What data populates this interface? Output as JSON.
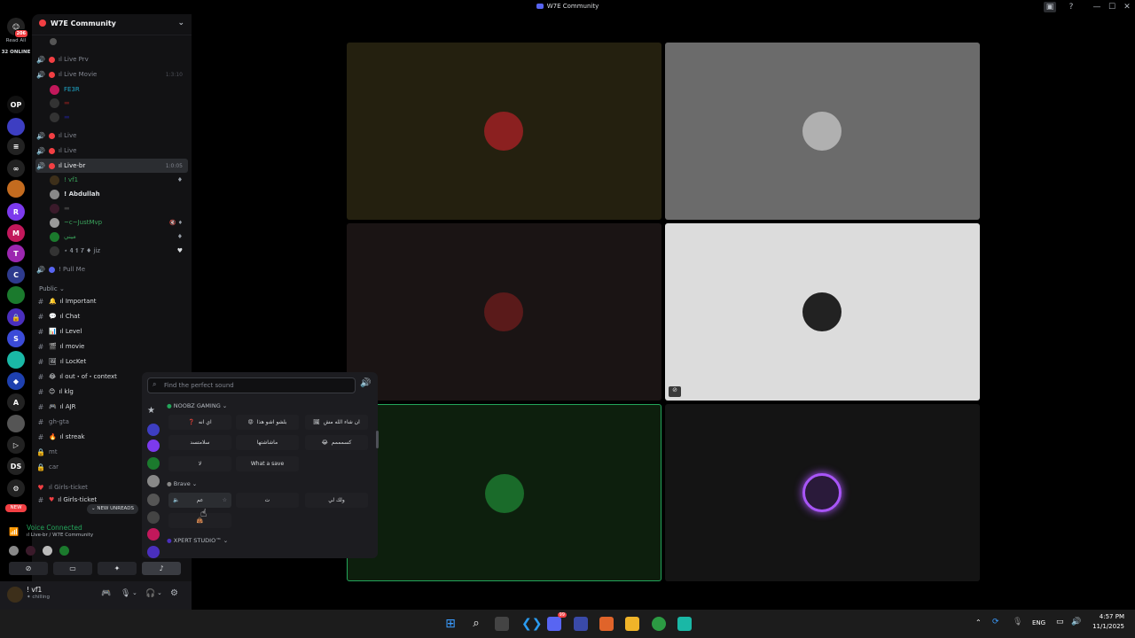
{
  "window": {
    "title": "W7E Community",
    "minimize": "—",
    "maximize": "☐",
    "close": "✕",
    "inbox_icon": "inbox-icon",
    "help_icon": "?"
  },
  "guilds": {
    "unread_badge": "206",
    "read_all": "Read All",
    "online": "32 ONLINE",
    "new_label": "NEW",
    "items": [
      {
        "name": "OP",
        "color": "#111",
        "text": "OP"
      },
      {
        "name": "server-a",
        "color": "#3d3ec2",
        "text": ""
      },
      {
        "name": "server-b",
        "color": "#222",
        "text": "≡"
      },
      {
        "name": "server-c",
        "color": "#222",
        "text": "∞"
      },
      {
        "name": "server-d",
        "color": "#c36b1f",
        "text": ""
      },
      {
        "name": "server-e",
        "color": "#7c3aed",
        "text": "R"
      },
      {
        "name": "server-f",
        "color": "#c2185b",
        "text": "M"
      },
      {
        "name": "server-g",
        "color": "#9c27b0",
        "text": "T"
      },
      {
        "name": "server-h",
        "color": "#2e3b8e",
        "text": "C"
      },
      {
        "name": "server-i",
        "color": "#1b7a2d",
        "text": ""
      },
      {
        "name": "server-j",
        "color": "#4a2fbd",
        "text": "🔒"
      },
      {
        "name": "server-k",
        "color": "#3b4bd8",
        "text": "S"
      },
      {
        "name": "server-l",
        "color": "#1ab8a6",
        "text": ""
      },
      {
        "name": "server-m",
        "color": "#1e40af",
        "text": "◆"
      },
      {
        "name": "server-n",
        "color": "#222",
        "text": "A"
      },
      {
        "name": "server-o",
        "color": "#555",
        "text": ""
      },
      {
        "name": "server-p",
        "color": "#222",
        "text": "▷"
      },
      {
        "name": "server-q",
        "color": "#222",
        "text": "DS"
      },
      {
        "name": "server-r",
        "color": "#222",
        "text": "⚙"
      }
    ],
    "badges": [
      "4",
      "40",
      "1",
      "16"
    ]
  },
  "server": {
    "name": "W7E Community",
    "chevron": "⌄"
  },
  "channels": [
    {
      "type": "voice",
      "name": "ıl Live Prv",
      "red": true
    },
    {
      "type": "voice",
      "name": "ıl Live Movie",
      "red": true,
      "right": "1:3:10"
    },
    {
      "type": "voice",
      "name": "ıl Live",
      "red": true
    },
    {
      "type": "voice",
      "name": "ıl Live",
      "red": true
    },
    {
      "type": "voice",
      "name": "ıl Live-br",
      "red": true,
      "right": "1:0:05",
      "active": true
    },
    {
      "type": "voice",
      "name": "! Pull Me"
    }
  ],
  "voice_users": [
    {
      "name": "FE3R",
      "color": "#1ea7c9",
      "right": "🔇 🎧"
    },
    {
      "name": "! vf1",
      "color": "#3ba55d",
      "right": "♦"
    },
    {
      "name": "! Abdullah",
      "color": "#dbdee1",
      "right": ""
    },
    {
      "name": "~c~JustMvp",
      "color": "#3ba55d",
      "right": "🔇 ♦"
    },
    {
      "name": "ميني",
      "color": "#3ba55d",
      "right": "♦"
    },
    {
      "name": "⋆ 𝟒 𝟏 𝟕 ♦ jiz",
      "color": "#80848e",
      "right": "♥"
    }
  ],
  "category_public": "Public ⌄",
  "text_channels": [
    {
      "emoji": "🔔",
      "name": "ıl Important"
    },
    {
      "emoji": "💬",
      "name": "ıl Chat"
    },
    {
      "emoji": "📊",
      "name": "ıl Level"
    },
    {
      "emoji": "🎬",
      "name": "ıl movie"
    },
    {
      "emoji": "🖼",
      "name": "ıl LocKet"
    },
    {
      "emoji": "😂",
      "name": "ıl out・of・context"
    },
    {
      "emoji": "😊",
      "name": "ıl klg"
    },
    {
      "emoji": "🎮",
      "name": "ıl AJR"
    },
    {
      "emoji": "",
      "name": "gh-gta"
    },
    {
      "emoji": "🔥",
      "name": "ıl streak"
    },
    {
      "emoji": "",
      "name": "mt"
    },
    {
      "emoji": "",
      "name": "car"
    }
  ],
  "girls_category": "ıl Girls-ticket",
  "girls_channel": "ıl Girls-ticket",
  "new_unreads": "NEW UNREADS",
  "voice_status": {
    "title": "Voice Connected",
    "subtitle": "ıl Live-br / W7E Community"
  },
  "user": {
    "name": "! vf1",
    "status": "chilling"
  },
  "soundboard": {
    "search_placeholder": "Find the perfect sound",
    "sections": [
      {
        "name": "NOOBZ GAMING ⌄",
        "sounds": [
          "اي انه",
          "بلشو اشو هذا",
          "ان شاء الله مش",
          "سلامتسد",
          "ماشاشتها",
          "كسمممم",
          "لا",
          "What a save"
        ]
      },
      {
        "name": "Brave ⌄",
        "sounds": [
          "عم",
          "ت",
          "ولك لي",
          ""
        ]
      },
      {
        "name": "XPERT STUDIO™ ⌄",
        "sounds": []
      }
    ]
  },
  "stage_tiles": [
    {
      "name": "tile-1",
      "bg": "#24200f",
      "avatar": "#8b2020"
    },
    {
      "name": "tile-2",
      "bg": "#6b6b6b",
      "avatar": "#b0b0b0"
    },
    {
      "name": "tile-3",
      "bg": "#1a1414",
      "avatar": "#5a1a1a"
    },
    {
      "name": "tile-4",
      "bg": "#dcdcdc",
      "avatar": "#222"
    },
    {
      "name": "tile-5",
      "bg": "#0d1f0d",
      "avatar": "#1a6b2a"
    },
    {
      "name": "tile-6",
      "bg": "#141414",
      "avatar": "#2a1a3a"
    }
  ],
  "taskbar": {
    "lang": "ENG",
    "time": "4:57 PM",
    "date": "11/1/2025",
    "badge": "99"
  },
  "colors": {
    "accent": "#5865f2",
    "green": "#23a55a",
    "red": "#f23f43"
  }
}
